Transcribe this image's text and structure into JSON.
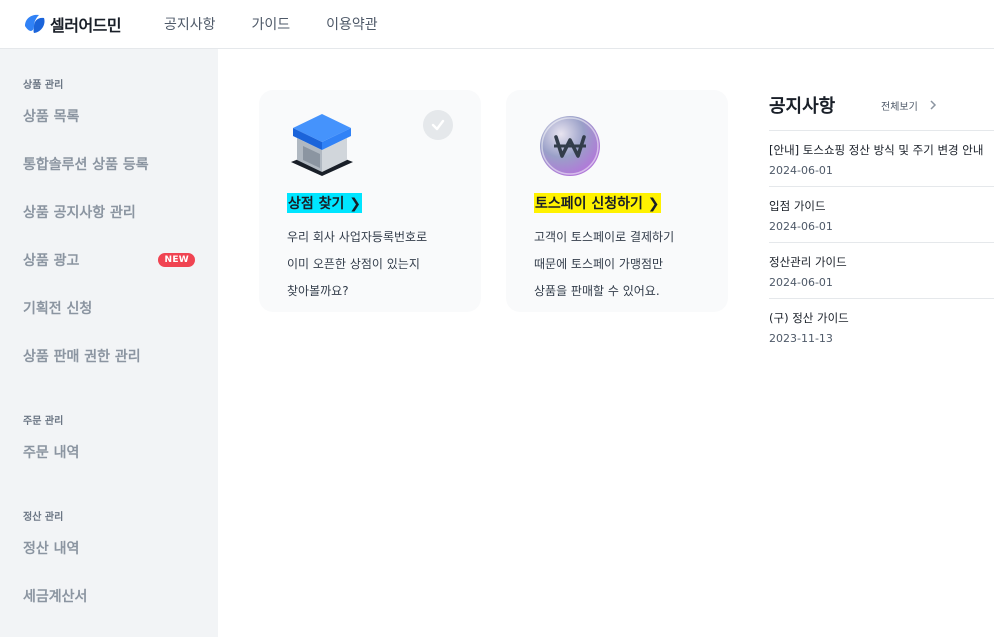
{
  "header": {
    "logo_text": "셀러어드민",
    "nav": [
      "공지사항",
      "가이드",
      "이용약관"
    ]
  },
  "sidebar": {
    "sections": [
      {
        "title": "상품 관리",
        "items": [
          "상품 목록",
          "통합솔루션 상품 등록",
          "상품 공지사항 관리",
          "상품 광고",
          "기획전 신청",
          "상품 판매 권한 관리"
        ]
      },
      {
        "title": "주문 관리",
        "items": [
          "주문 내역"
        ]
      },
      {
        "title": "정산 관리",
        "items": [
          "정산 내역",
          "세금계산서"
        ]
      }
    ],
    "new_badge": "NEW"
  },
  "cards": [
    {
      "title": "상점 찾기",
      "desc": [
        "우리 회사 사업자등록번호로",
        "이미 오픈한 상점이 있는지",
        "찾아볼까요?"
      ],
      "icon": "store-box-icon",
      "checked": true
    },
    {
      "title": "토스페이 신청하기",
      "desc": [
        "고객이 토스페이로 결제하기",
        "때문에 토스페이 가맹점만",
        "상품을 판매할 수 있어요."
      ],
      "icon": "won-coin-icon"
    }
  ],
  "notice": {
    "title": "공지사항",
    "view_all": "전체보기",
    "items": [
      {
        "title": "[안내] 토스쇼핑 정산 방식 및 주기 변경 안내",
        "date": "2024-06-01"
      },
      {
        "title": "입점 가이드",
        "date": "2024-06-01"
      },
      {
        "title": "정산관리 가이드",
        "date": "2024-06-01"
      },
      {
        "title": "(구) 정산 가이드",
        "date": "2023-11-13"
      }
    ]
  },
  "colors": {
    "brand": "#3182f6",
    "badge": "#f04452",
    "highlight_cyan": "#00e5ff",
    "highlight_yellow": "#fff200"
  }
}
